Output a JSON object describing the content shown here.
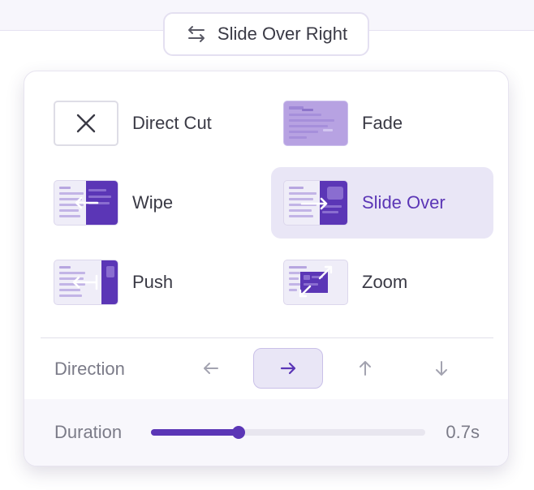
{
  "trigger": {
    "label": "Slide Over Right",
    "icon": "swap-arrows-icon"
  },
  "transitions": [
    {
      "label": "Direct Cut",
      "icon": "close-icon",
      "selected": false
    },
    {
      "label": "Fade",
      "icon": "fade-preview-icon",
      "selected": false
    },
    {
      "label": "Wipe",
      "icon": "wipe-preview-icon",
      "selected": false
    },
    {
      "label": "Slide Over",
      "icon": "slide-over-preview-icon",
      "selected": true
    },
    {
      "label": "Push",
      "icon": "push-preview-icon",
      "selected": false
    },
    {
      "label": "Zoom",
      "icon": "zoom-preview-icon",
      "selected": false
    }
  ],
  "direction": {
    "label": "Direction",
    "options": [
      {
        "icon": "arrow-left-icon",
        "active": false
      },
      {
        "icon": "arrow-right-icon",
        "active": true
      },
      {
        "icon": "arrow-up-icon",
        "active": false
      },
      {
        "icon": "arrow-down-icon",
        "active": false
      }
    ]
  },
  "duration": {
    "label": "Duration",
    "value": "0.7s",
    "fraction": 0.32
  },
  "colors": {
    "accent": "#5b36b6",
    "accent_light": "#a78bdc",
    "selected_bg": "#e9e6f6",
    "text": "#3a3a45",
    "muted_text": "#7b7b88"
  }
}
